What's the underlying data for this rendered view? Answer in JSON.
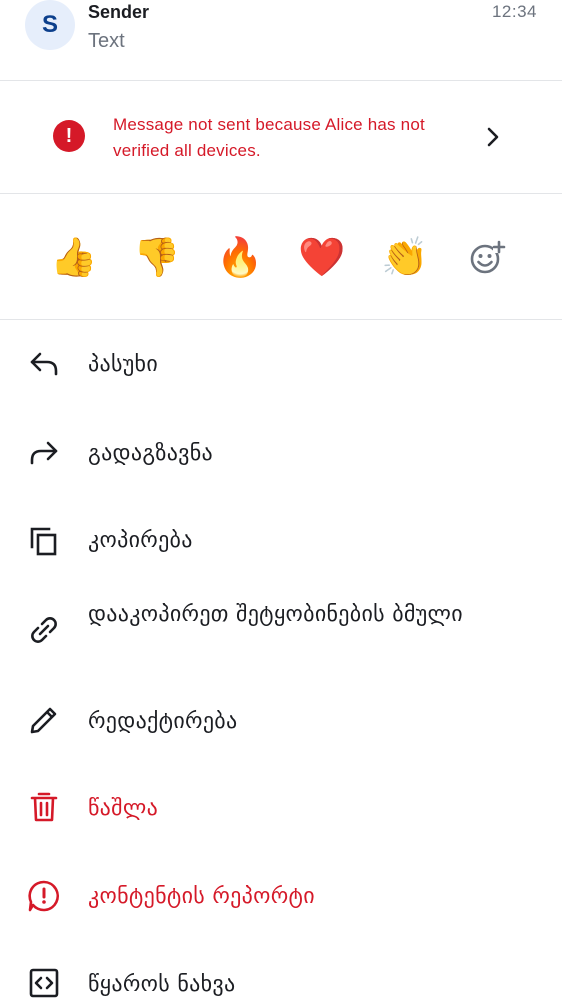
{
  "header": {
    "avatar_letter": "S",
    "sender": "Sender",
    "text": "Text",
    "time": "12:34"
  },
  "banner": {
    "text": "Message not sent because Alice has not verified all devices."
  },
  "reactions": {
    "items": [
      "👍",
      "👎",
      "🔥",
      "❤️",
      "👏"
    ]
  },
  "menu": {
    "reply": "პასუხი",
    "forward": "გადაგზავნა",
    "copy": "კოპირება",
    "copy_link": "დააკოპირეთ შეტყობინების ბმული",
    "edit": "რედაქტირება",
    "delete": "წაშლა",
    "report": "კონტენტის რეპორტი",
    "view_source": "წყაროს ნახვა"
  },
  "colors": {
    "danger": "#d51928",
    "avatar_bg": "#e6eefb",
    "avatar_fg": "#0c3f8c"
  }
}
